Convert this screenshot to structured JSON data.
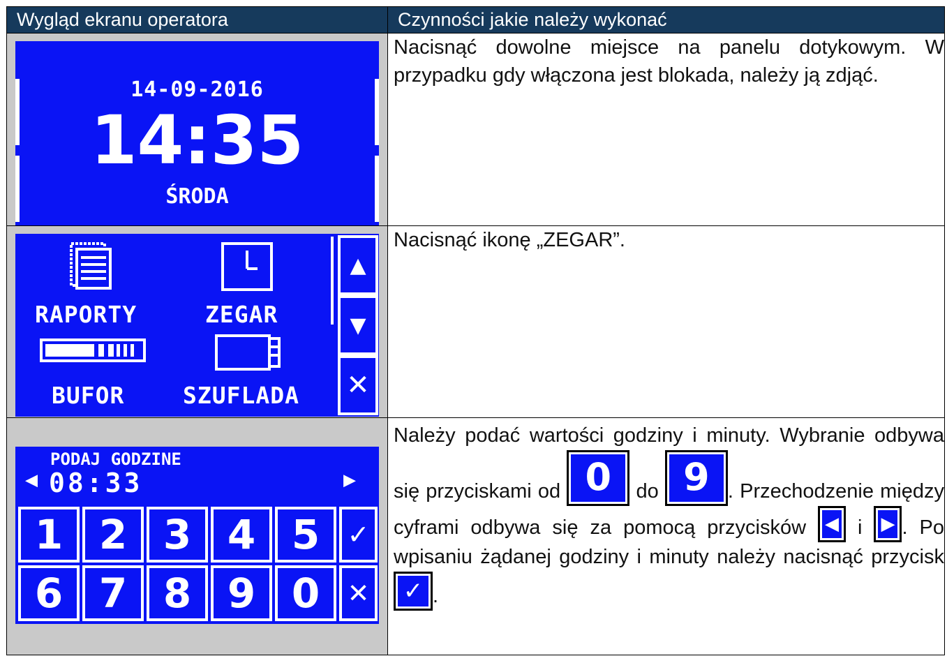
{
  "header": {
    "col1": "Wygląd ekranu operatora",
    "col2": "Czynności jakie należy wykonać"
  },
  "row1": {
    "screen": {
      "date": "14-09-2016",
      "time": "14:35",
      "day": "ŚRODA"
    },
    "text": "Nacisnąć dowolne miejsce na panelu dotykowym. W przypadku gdy włączona jest blokada, należy ją zdjąć."
  },
  "row2": {
    "screen": {
      "items": [
        "RAPORTY",
        "ZEGAR",
        "BUFOR",
        "SZUFLADA"
      ],
      "up": "▲",
      "down": "▼",
      "close": "✕"
    },
    "text": "Nacisnąć ikonę „ZEGAR”."
  },
  "row3": {
    "screen": {
      "title": "PODAJ GODZINE",
      "value": "08:33",
      "left_arrow": "◀",
      "right_arrow": "▶",
      "keys_top": [
        "1",
        "2",
        "3",
        "4",
        "5"
      ],
      "keys_bottom": [
        "6",
        "7",
        "8",
        "9",
        "0"
      ],
      "ok": "✓",
      "cancel": "✕"
    },
    "text": {
      "p1": "Należy podać wartości godziny i minuty. Wybranie odbywa się przyciskami od",
      "key_from": "0",
      "p2": "do",
      "key_to": "9",
      "p3": ". Przechodzenie między cyframi odbywa się za pomocą przycisków",
      "btn_left": "◀",
      "p4": "i",
      "btn_right": "▶",
      "p5": ". Po wpisaniu żądanej godziny i minuty należy nacisnąć przycisk",
      "btn_ok": "✓",
      "p6": "."
    }
  },
  "colors": {
    "header_bg": "#163a5c",
    "screen_blue": "#0a14f5",
    "cell_gray": "#c9c9c9"
  }
}
